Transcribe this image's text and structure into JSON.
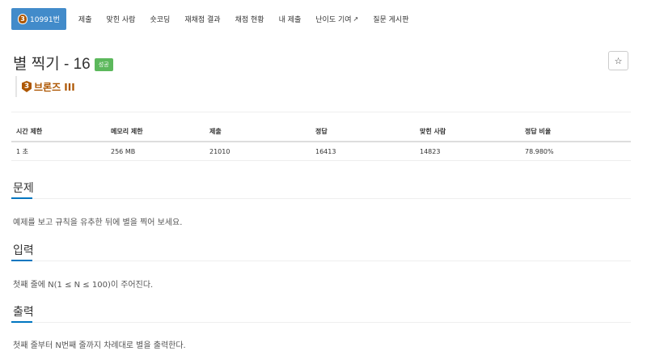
{
  "tabs": [
    {
      "label": "10991번",
      "badge": "3"
    },
    {
      "label": "제출"
    },
    {
      "label": "맞힌 사람"
    },
    {
      "label": "숏코딩"
    },
    {
      "label": "재채점 결과"
    },
    {
      "label": "채점 현황"
    },
    {
      "label": "내 제출"
    },
    {
      "label": "난이도 기여"
    },
    {
      "label": "질문 게시판"
    }
  ],
  "problem": {
    "title": "별 찍기 - 16",
    "status_badge": "성공",
    "star": "☆",
    "tier_number": "3",
    "tier_label": "브론즈 III",
    "tier_color": "#ad5600"
  },
  "info": {
    "headers": [
      "시간 제한",
      "메모리 제한",
      "제출",
      "정답",
      "맞힌 사람",
      "정답 비율"
    ],
    "values": [
      "1 초",
      "256 MB",
      "21010",
      "16413",
      "14823",
      "78.980%"
    ]
  },
  "sections": {
    "description_title": "문제",
    "description_text": "예제를 보고 규칙을 유추한 뒤에 별을 찍어 보세요.",
    "input_title": "입력",
    "input_text": "첫째 줄에 N(1 ≤ N ≤ 100)이 주어진다.",
    "output_title": "출력",
    "output_text": "첫째 줄부터 N번째 줄까지 차례대로 별을 출력한다."
  },
  "colors": {
    "active_tab": "#428bca",
    "success": "#5cb85c",
    "section_accent": "#0076c0"
  }
}
